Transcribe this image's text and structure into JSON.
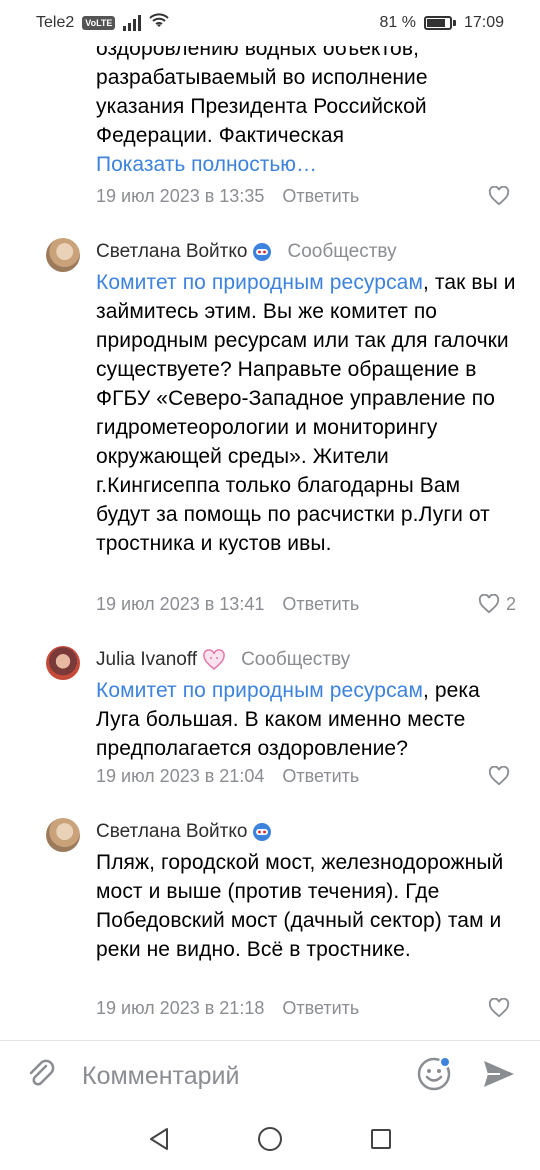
{
  "status": {
    "carrier": "Tele2",
    "volte": "VoLTE",
    "battery": "81 %",
    "time": "17:09"
  },
  "comments": [
    {
      "text_lines": "оздоровлению водных объектов, разрабатываемый во исполнение указания Президента Российской Федерации. Фактическая",
      "show_more": "Показать полностью…",
      "date": "19 июл 2023 в 13:35",
      "reply": "Ответить",
      "likes": ""
    },
    {
      "author": "Светлана Войтко",
      "community": "Сообществу",
      "mention": "Комитет по природным ресурсам",
      "text": ", так вы и займитесь этим. Вы же комитет по природным ресурсам или так для галочки существуете? Направьте обращение в ФГБУ «Северо-Западное управление по гидрометеорологии и мониторингу окружающей среды». Жители г.Кингисеппа только благодарны Вам будут за помощь по расчистки р.Луги от тростника и кустов ивы.",
      "date": "19 июл 2023 в 13:41",
      "reply": "Ответить",
      "likes": "2"
    },
    {
      "author": "Julia Ivanoff",
      "community": "Сообществу",
      "mention": "Комитет по природным ресурсам",
      "text": ", река Луга большая. В каком именно месте предполагается оздоровление?",
      "date": "19 июл 2023 в 21:04",
      "reply": "Ответить",
      "likes": ""
    },
    {
      "author": "Светлана Войтко",
      "community": "",
      "mention": "",
      "text": "Пляж, городской мост, железнодорожный мост и выше (против течения). Где Победовский мост (дачный сектор) там и реки не видно. Всё в тростнике.",
      "date": "19 июл 2023 в 21:18",
      "reply": "Ответить",
      "likes": ""
    }
  ],
  "composer": {
    "placeholder": "Комментарий"
  },
  "icons": {
    "attach": "paperclip-icon",
    "emoji": "smile-icon",
    "send": "send-icon",
    "like": "heart-icon",
    "nav_back": "triangle-back-icon",
    "nav_home": "circle-home-icon",
    "nav_recent": "square-recent-icon"
  },
  "colors": {
    "link": "#3d83dd",
    "meta": "#8a8d91",
    "text": "#000000"
  }
}
